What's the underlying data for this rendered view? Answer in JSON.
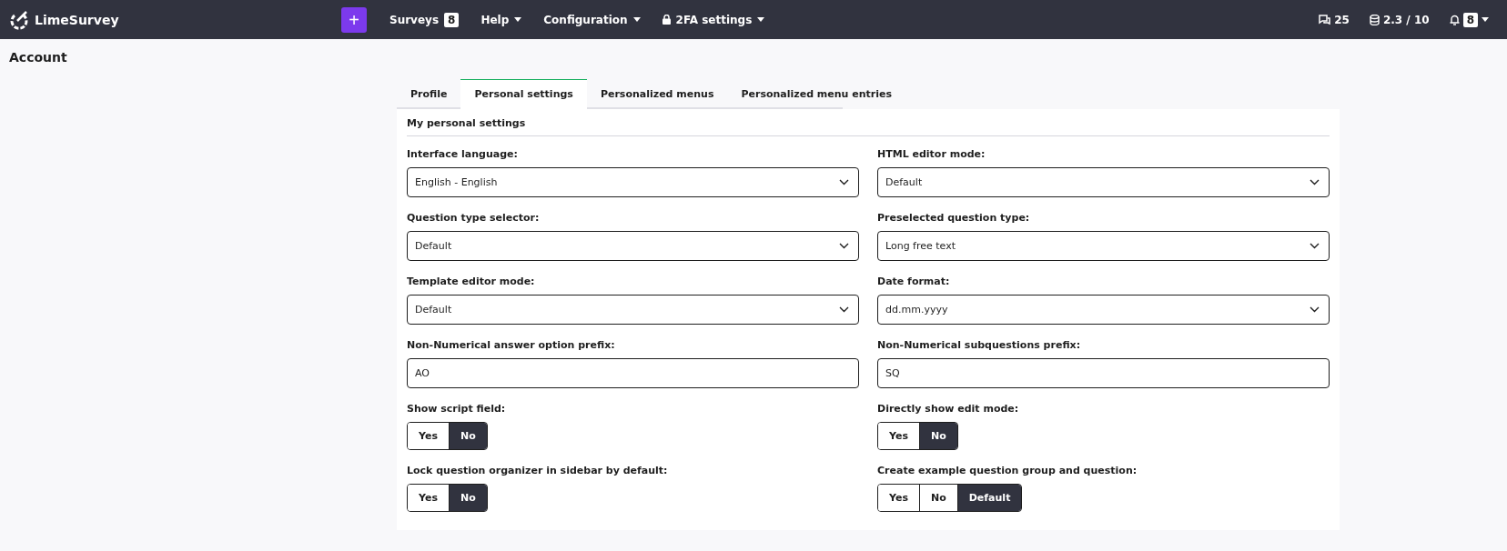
{
  "topbar": {
    "brand": "LimeSurvey",
    "add_button": "+",
    "menu": [
      {
        "label": "Surveys",
        "badge": "8",
        "kind": "badge"
      },
      {
        "label": "Help",
        "kind": "dropdown"
      },
      {
        "label": "Configuration",
        "kind": "dropdown"
      },
      {
        "label": "2FA settings",
        "kind": "lock-dropdown"
      }
    ],
    "status": [
      {
        "kind": "responses",
        "text": "25"
      },
      {
        "kind": "storage",
        "text": "2.3 / 10"
      },
      {
        "kind": "notifications",
        "text": "8"
      }
    ]
  },
  "page_title": "Account",
  "tabs": [
    {
      "label": "Profile",
      "selected": false
    },
    {
      "label": "Personal settings",
      "selected": true
    },
    {
      "label": "Personalized menus",
      "selected": false
    },
    {
      "label": "Personalized menu entries",
      "selected": false
    }
  ],
  "section_title": "My personal settings",
  "fields": [
    {
      "kind": "select",
      "label": "Interface language:",
      "value": "English - English"
    },
    {
      "kind": "select",
      "label": "HTML editor mode:",
      "value": "Default"
    },
    {
      "kind": "select",
      "label": "Question type selector:",
      "value": "Default"
    },
    {
      "kind": "select",
      "label": "Preselected question type:",
      "value": "Long free text"
    },
    {
      "kind": "select",
      "label": "Template editor mode:",
      "value": "Default"
    },
    {
      "kind": "select",
      "label": "Date format:",
      "value": "dd.mm.yyyy"
    },
    {
      "kind": "text",
      "label": "Non-Numerical answer option prefix:",
      "value": "AO"
    },
    {
      "kind": "text",
      "label": "Non-Numerical subquestions prefix:",
      "value": "SQ"
    },
    {
      "kind": "toggle",
      "label": "Show script field:",
      "options": [
        {
          "label": "Yes",
          "selected": false
        },
        {
          "label": "No",
          "selected": true
        }
      ]
    },
    {
      "kind": "toggle",
      "label": "Directly show edit mode:",
      "options": [
        {
          "label": "Yes",
          "selected": false
        },
        {
          "label": "No",
          "selected": true
        }
      ]
    },
    {
      "kind": "toggle",
      "label": "Lock question organizer in sidebar by default:",
      "options": [
        {
          "label": "Yes",
          "selected": false
        },
        {
          "label": "No",
          "selected": true
        }
      ]
    },
    {
      "kind": "toggle",
      "label": "Create example question group and question:",
      "options": [
        {
          "label": "Yes",
          "selected": false
        },
        {
          "label": "No",
          "selected": false
        },
        {
          "label": "Default",
          "selected": true
        }
      ]
    }
  ]
}
